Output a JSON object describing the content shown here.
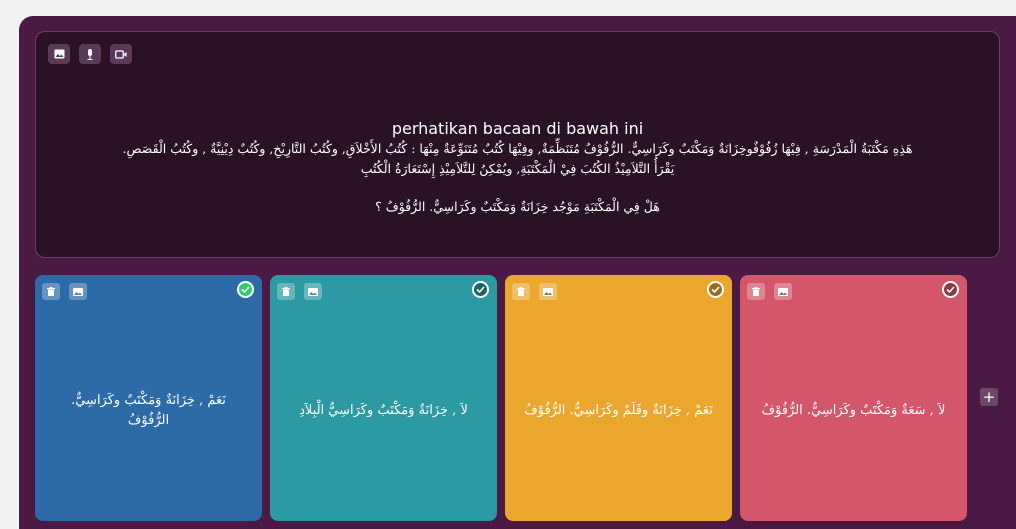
{
  "question": {
    "title": "perhatikan bacaan di bawah ini",
    "line1": "هَذِهِ مَكْتَبَةُ الْمَدْرَسَةِ , فِيْهَا زُفُوْفٌوخِزَانَةٌ وَمَكْتَبٌ وكَرَاسِيٌّ. الرُّفُوْفُ مُتَنَظِّمَةٌ, وفِيْهَا كُتُبٌ مُتَنَوِّعَةٌ مِنْهَا : كُتُبُ الأَخْلاَقِ, وكُتُبُ التَّارِيْخِ, وكُتُبٌ دِيْنِيَّةٌ , وكُتُبُ الْقَصَصِ.",
    "line2": "يَقْرَأُ التَّلاَمِيْذُ الكُتُبَ فِيْ الْمَكْتَبَةِ, ويُمْكِنُ لِلتَّلاَمِيْذِ إِسْتَعَارَةُ الْكُتُبِ",
    "line3": "هَلْ فِي الْمَكْتَبَةِ مَوْجُد  خِزَانَةٌ وَمَكْتَبٌ وكَرَاسِيٌّ. الرُّفُوْفُ ؟"
  },
  "toolbar": {
    "icons": [
      "image-icon",
      "microphone-icon",
      "video-icon"
    ]
  },
  "answers": [
    {
      "text": "نَعَمْ , خِزَانَةٌ وَمَكْتَبٌ وكَرَاسِيٌّ. الرُّفُوْفُ",
      "color": "#2c6aa8",
      "correct": true
    },
    {
      "text": "لاَ , خِزَانَةٌ وَمَكْتَبٌ وكَرَاسِيٌّ الْبِلاَدِ",
      "color": "#2b9aa2",
      "correct": false
    },
    {
      "text": "نَعَمْ , خِزَانَةٌ وقَلَمٌ وكَرَاسِيٌّ. الرُّفُوْفُ",
      "color": "#eaa62d",
      "correct": false
    },
    {
      "text": "لاَ , سَعَةٌ وَمَكْتَبٌ وكَرَاسِيٌّ. الرُّفُوْفُ",
      "color": "#d4566b",
      "correct": false
    }
  ],
  "add_button": {
    "label": "+"
  }
}
